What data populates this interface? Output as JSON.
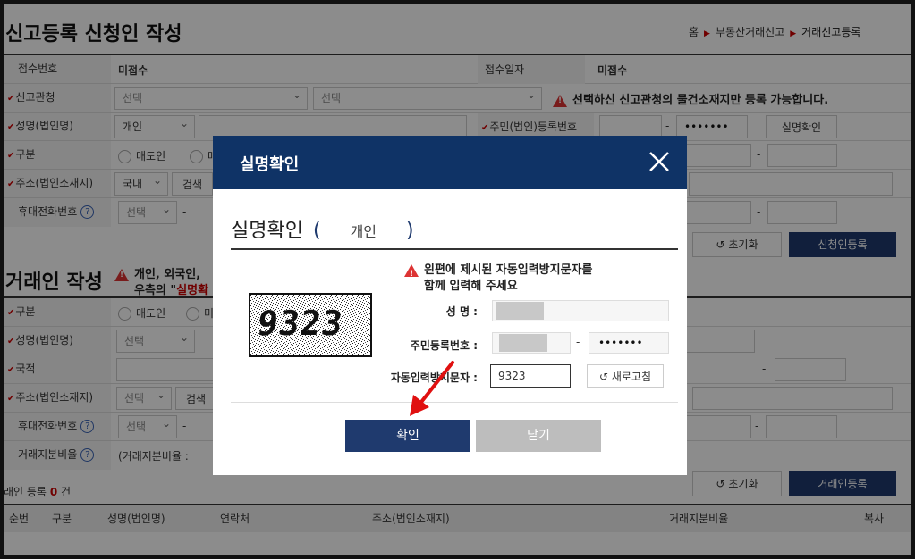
{
  "page": {
    "title": "신고등록 신청인 작성",
    "breadcrumb": [
      "홈",
      "부동산거래신고",
      "거래신고등록"
    ],
    "form": {
      "receipt_no_label": "접수번호",
      "receipt_no_value": "미접수",
      "receipt_date_label": "접수일자",
      "receipt_date_value": "미접수",
      "agency_label": "신고관청",
      "agency_select1": "선택",
      "agency_select2": "선택",
      "agency_notice": "선택하신 신고관청의 물건소재지만 등록 가능합니다.",
      "name_label": "성명(법인명)",
      "name_type": "개인",
      "rrn_label": "주민(법인)등록번호",
      "rrn_dash": "-",
      "rrn_masked": "•••••••",
      "verify_button": "실명확인",
      "type_label": "구분",
      "type_option1": "매도인",
      "type_option2_partial": "매",
      "address_label": "주소(법인소재지)",
      "address_country": "국내",
      "address_search": "검색",
      "phone_label": "휴대전화번호",
      "phone_select": "선택",
      "reset_button": "초기화",
      "register_button": "신청인등록"
    },
    "party": {
      "title": "거래인 작성",
      "notice_line1": "개인, 외국인,",
      "notice_line2_prefix": "우측의 \"",
      "notice_line2_red": "실명확",
      "type_label": "구분",
      "type_option1": "매도인",
      "type_option2_partial": "미",
      "name_label": "성명(법인명)",
      "name_select": "선택",
      "nationality_label": "국적",
      "address_label": "주소(법인소재지)",
      "address_select": "선택",
      "address_search": "검색",
      "phone_label": "휴대전화번호",
      "phone_select": "선택",
      "ratio_label": "거래지분비율",
      "ratio_value": "(거래지분비율 :",
      "reset_button": "초기화",
      "register_button": "거래인등록",
      "count_prefix": "래인 등록",
      "count_value": "0",
      "count_suffix": "건"
    },
    "table": {
      "headers": [
        "순번",
        "구분",
        "성명(법인명)",
        "연락처",
        "주소(법인소재지)",
        "거래지분비율",
        "복사"
      ]
    }
  },
  "modal": {
    "header_title": "실명확인",
    "heading_prefix": "실명확인",
    "heading_paren_open": "(",
    "heading_type": "개인",
    "heading_paren_close": ")",
    "notice_line1": "왼편에 제시된 자동입력방지문자를",
    "notice_line2": "함께 입력해 주세요",
    "name_label": "성     명 :",
    "rrn_label": "주민등록번호 :",
    "rrn_dash": "-",
    "rrn_masked": "•••••••",
    "captcha_label": "자동입력방지문자 :",
    "captcha_image_text": "9323",
    "captcha_input_value": "9323",
    "refresh_button": "새로고침",
    "confirm_button": "확인",
    "close_button": "닫기"
  },
  "colors": {
    "navy": "#0f3366",
    "button_navy": "#1f3a6e",
    "required_red": "#cc0000",
    "arrow_red": "#e01010",
    "close_gray": "#bdbdbd"
  }
}
